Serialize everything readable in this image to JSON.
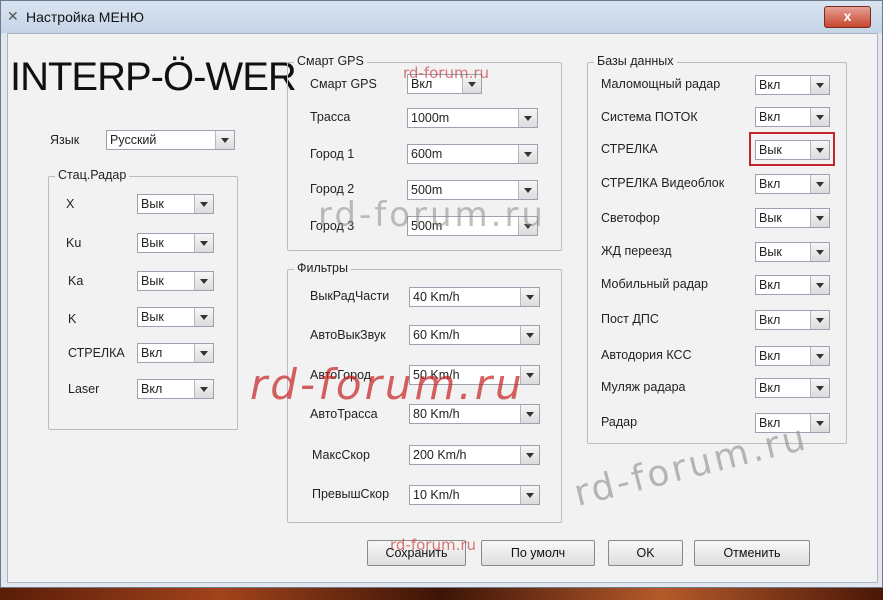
{
  "window": {
    "title": "Настройка МЕНЮ",
    "close_glyph": "x"
  },
  "logo": "INTERP-Ö-WER",
  "language": {
    "label": "Язык",
    "value": "Русский"
  },
  "radar": {
    "title": "Стац.Радар",
    "rows": [
      {
        "label": "X",
        "value": "Вык"
      },
      {
        "label": "Ku",
        "value": "Вык"
      },
      {
        "label": "Ka",
        "value": "Вык"
      },
      {
        "label": "K",
        "value": "Вык"
      },
      {
        "label": "СТРЕЛКА",
        "value": "Вкл"
      },
      {
        "label": "Laser",
        "value": "Вкл"
      }
    ]
  },
  "gps": {
    "title": "Смарт GPS",
    "rows": [
      {
        "label": "Смарт GPS",
        "value": "Вкл"
      },
      {
        "label": "Трасса",
        "value": "1000m"
      },
      {
        "label": "Город 1",
        "value": "600m"
      },
      {
        "label": "Город 2",
        "value": "500m"
      },
      {
        "label": "Город 3",
        "value": "500m"
      }
    ]
  },
  "filters": {
    "title": "Фильтры",
    "rows": [
      {
        "label": "ВыкРадЧасти",
        "value": "40 Km/h"
      },
      {
        "label": "АвтоВыкЗвук",
        "value": "60 Km/h"
      },
      {
        "label": "АвтоГород",
        "value": "50 Km/h"
      },
      {
        "label": "АвтоТрасса",
        "value": "80 Km/h"
      },
      {
        "label": "МаксСкор",
        "value": "200 Km/h"
      },
      {
        "label": "ПревышСкор",
        "value": "10 Km/h"
      }
    ]
  },
  "db": {
    "title": "Базы данных",
    "rows": [
      {
        "label": "Маломощный радар",
        "value": "Вкл"
      },
      {
        "label": "Система ПОТОК",
        "value": "Вкл"
      },
      {
        "label": "СТРЕЛКА",
        "value": "Вык"
      },
      {
        "label": "СТРЕЛКА Видеоблок",
        "value": "Вкл"
      },
      {
        "label": "Светофор",
        "value": "Вык"
      },
      {
        "label": "ЖД переезд",
        "value": "Вык"
      },
      {
        "label": "Мобильный радар",
        "value": "Вкл"
      },
      {
        "label": "Пост ДПС",
        "value": "Вкл"
      },
      {
        "label": "Автодория КСС",
        "value": "Вкл"
      },
      {
        "label": "Муляж радара",
        "value": "Вкл"
      },
      {
        "label": "Радар",
        "value": "Вкл"
      }
    ]
  },
  "buttons": {
    "save": "Сохранить",
    "default": "По умолч",
    "ok": "OK",
    "cancel": "Отменить"
  },
  "watermark": "rd-forum.ru",
  "colors": {
    "highlight": "#c0272d",
    "close": "#c8462d"
  }
}
